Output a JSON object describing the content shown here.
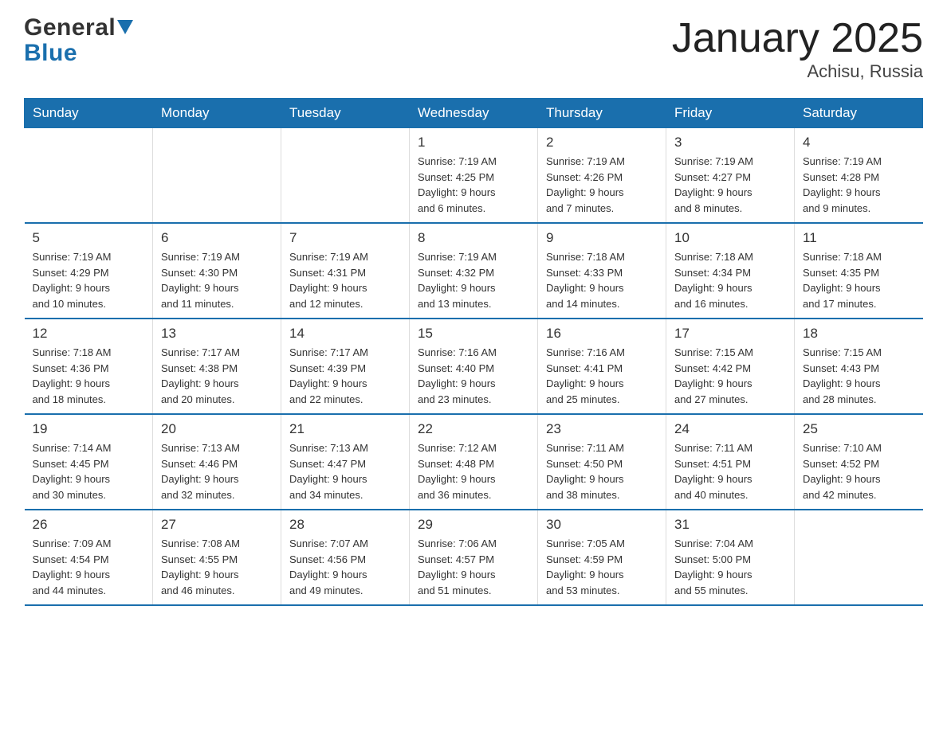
{
  "header": {
    "logo_general": "General",
    "logo_blue": "Blue",
    "title": "January 2025",
    "subtitle": "Achisu, Russia"
  },
  "days_of_week": [
    "Sunday",
    "Monday",
    "Tuesday",
    "Wednesday",
    "Thursday",
    "Friday",
    "Saturday"
  ],
  "weeks": [
    [
      {
        "day": "",
        "info": ""
      },
      {
        "day": "",
        "info": ""
      },
      {
        "day": "",
        "info": ""
      },
      {
        "day": "1",
        "info": "Sunrise: 7:19 AM\nSunset: 4:25 PM\nDaylight: 9 hours\nand 6 minutes."
      },
      {
        "day": "2",
        "info": "Sunrise: 7:19 AM\nSunset: 4:26 PM\nDaylight: 9 hours\nand 7 minutes."
      },
      {
        "day": "3",
        "info": "Sunrise: 7:19 AM\nSunset: 4:27 PM\nDaylight: 9 hours\nand 8 minutes."
      },
      {
        "day": "4",
        "info": "Sunrise: 7:19 AM\nSunset: 4:28 PM\nDaylight: 9 hours\nand 9 minutes."
      }
    ],
    [
      {
        "day": "5",
        "info": "Sunrise: 7:19 AM\nSunset: 4:29 PM\nDaylight: 9 hours\nand 10 minutes."
      },
      {
        "day": "6",
        "info": "Sunrise: 7:19 AM\nSunset: 4:30 PM\nDaylight: 9 hours\nand 11 minutes."
      },
      {
        "day": "7",
        "info": "Sunrise: 7:19 AM\nSunset: 4:31 PM\nDaylight: 9 hours\nand 12 minutes."
      },
      {
        "day": "8",
        "info": "Sunrise: 7:19 AM\nSunset: 4:32 PM\nDaylight: 9 hours\nand 13 minutes."
      },
      {
        "day": "9",
        "info": "Sunrise: 7:18 AM\nSunset: 4:33 PM\nDaylight: 9 hours\nand 14 minutes."
      },
      {
        "day": "10",
        "info": "Sunrise: 7:18 AM\nSunset: 4:34 PM\nDaylight: 9 hours\nand 16 minutes."
      },
      {
        "day": "11",
        "info": "Sunrise: 7:18 AM\nSunset: 4:35 PM\nDaylight: 9 hours\nand 17 minutes."
      }
    ],
    [
      {
        "day": "12",
        "info": "Sunrise: 7:18 AM\nSunset: 4:36 PM\nDaylight: 9 hours\nand 18 minutes."
      },
      {
        "day": "13",
        "info": "Sunrise: 7:17 AM\nSunset: 4:38 PM\nDaylight: 9 hours\nand 20 minutes."
      },
      {
        "day": "14",
        "info": "Sunrise: 7:17 AM\nSunset: 4:39 PM\nDaylight: 9 hours\nand 22 minutes."
      },
      {
        "day": "15",
        "info": "Sunrise: 7:16 AM\nSunset: 4:40 PM\nDaylight: 9 hours\nand 23 minutes."
      },
      {
        "day": "16",
        "info": "Sunrise: 7:16 AM\nSunset: 4:41 PM\nDaylight: 9 hours\nand 25 minutes."
      },
      {
        "day": "17",
        "info": "Sunrise: 7:15 AM\nSunset: 4:42 PM\nDaylight: 9 hours\nand 27 minutes."
      },
      {
        "day": "18",
        "info": "Sunrise: 7:15 AM\nSunset: 4:43 PM\nDaylight: 9 hours\nand 28 minutes."
      }
    ],
    [
      {
        "day": "19",
        "info": "Sunrise: 7:14 AM\nSunset: 4:45 PM\nDaylight: 9 hours\nand 30 minutes."
      },
      {
        "day": "20",
        "info": "Sunrise: 7:13 AM\nSunset: 4:46 PM\nDaylight: 9 hours\nand 32 minutes."
      },
      {
        "day": "21",
        "info": "Sunrise: 7:13 AM\nSunset: 4:47 PM\nDaylight: 9 hours\nand 34 minutes."
      },
      {
        "day": "22",
        "info": "Sunrise: 7:12 AM\nSunset: 4:48 PM\nDaylight: 9 hours\nand 36 minutes."
      },
      {
        "day": "23",
        "info": "Sunrise: 7:11 AM\nSunset: 4:50 PM\nDaylight: 9 hours\nand 38 minutes."
      },
      {
        "day": "24",
        "info": "Sunrise: 7:11 AM\nSunset: 4:51 PM\nDaylight: 9 hours\nand 40 minutes."
      },
      {
        "day": "25",
        "info": "Sunrise: 7:10 AM\nSunset: 4:52 PM\nDaylight: 9 hours\nand 42 minutes."
      }
    ],
    [
      {
        "day": "26",
        "info": "Sunrise: 7:09 AM\nSunset: 4:54 PM\nDaylight: 9 hours\nand 44 minutes."
      },
      {
        "day": "27",
        "info": "Sunrise: 7:08 AM\nSunset: 4:55 PM\nDaylight: 9 hours\nand 46 minutes."
      },
      {
        "day": "28",
        "info": "Sunrise: 7:07 AM\nSunset: 4:56 PM\nDaylight: 9 hours\nand 49 minutes."
      },
      {
        "day": "29",
        "info": "Sunrise: 7:06 AM\nSunset: 4:57 PM\nDaylight: 9 hours\nand 51 minutes."
      },
      {
        "day": "30",
        "info": "Sunrise: 7:05 AM\nSunset: 4:59 PM\nDaylight: 9 hours\nand 53 minutes."
      },
      {
        "day": "31",
        "info": "Sunrise: 7:04 AM\nSunset: 5:00 PM\nDaylight: 9 hours\nand 55 minutes."
      },
      {
        "day": "",
        "info": ""
      }
    ]
  ]
}
